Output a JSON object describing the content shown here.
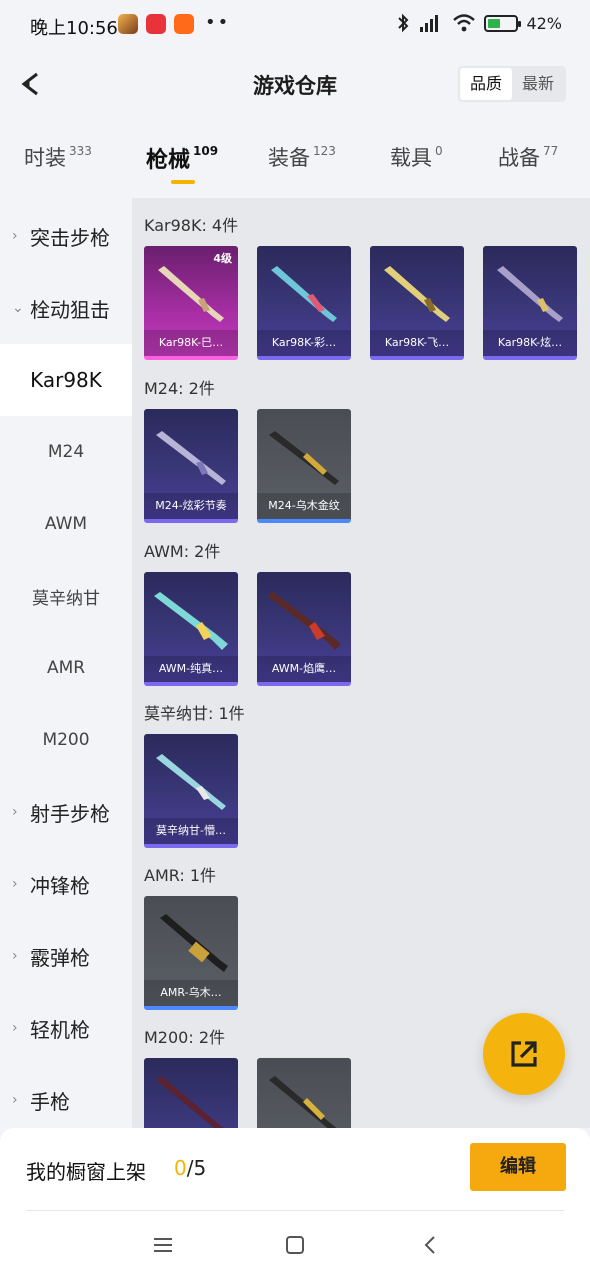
{
  "status_bar": {
    "time": "晚上10:56",
    "dots": "••",
    "battery": "42%"
  },
  "header": {
    "title": "游戏仓库",
    "sort": [
      "品质",
      "最新"
    ]
  },
  "tabs": [
    {
      "label": "时装",
      "count": "333"
    },
    {
      "label": "枪械",
      "count": "109"
    },
    {
      "label": "装备",
      "count": "123"
    },
    {
      "label": "载具",
      "count": "0"
    },
    {
      "label": "战备",
      "count": "77"
    }
  ],
  "sidebar": {
    "items": [
      {
        "label": "突击步枪"
      },
      {
        "label": "栓动狙击"
      },
      {
        "label": "Kar98K"
      },
      {
        "label": "M24"
      },
      {
        "label": "AWM"
      },
      {
        "label": "莫辛纳甘"
      },
      {
        "label": "AMR"
      },
      {
        "label": "M200"
      },
      {
        "label": "射手步枪"
      },
      {
        "label": "冲锋枪"
      },
      {
        "label": "霰弹枪"
      },
      {
        "label": "轻机枪"
      },
      {
        "label": "手枪"
      }
    ]
  },
  "sections": [
    {
      "title": "Kar98K: 4件",
      "cards": [
        {
          "name": "Kar98K-巳…",
          "level": "4级"
        },
        {
          "name": "Kar98K-彩…"
        },
        {
          "name": "Kar98K-飞…"
        },
        {
          "name": "Kar98K-炫…"
        }
      ]
    },
    {
      "title": "M24: 2件",
      "cards": [
        {
          "name": "M24-炫彩节奏"
        },
        {
          "name": "M24-乌木金纹"
        }
      ]
    },
    {
      "title": "AWM: 2件",
      "cards": [
        {
          "name": "AWM-纯真…"
        },
        {
          "name": "AWM-焰鹰…"
        }
      ]
    },
    {
      "title": "莫辛纳甘: 1件",
      "cards": [
        {
          "name": "莫辛纳甘-懵…"
        }
      ]
    },
    {
      "title": "AMR: 1件",
      "cards": [
        {
          "name": "AMR-乌木…"
        }
      ]
    },
    {
      "title": "M200: 2件",
      "cards": [
        {
          "name": ""
        },
        {
          "name": ""
        }
      ]
    }
  ],
  "bottom": {
    "shelf_label": "我的橱窗上架",
    "shelf_current": "0",
    "shelf_total": "/5",
    "edit": "编辑"
  },
  "colors": {
    "accent": "#f5b400",
    "edit_button": "#f6a80f",
    "purple_card": "#3a3778",
    "pink_card": "#a62ea3",
    "grey_card": "#5b5f66"
  },
  "icons": [
    "back-arrow-icon",
    "share-external-icon",
    "menu-icon",
    "home-square-icon",
    "nav-back-icon",
    "bluetooth-icon",
    "signal-icon",
    "wifi-icon",
    "battery-icon"
  ]
}
